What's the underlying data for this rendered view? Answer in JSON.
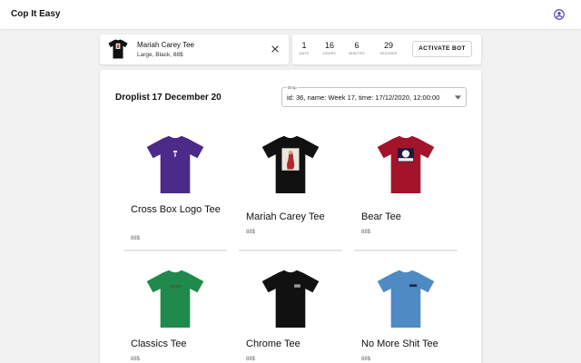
{
  "app": {
    "title": "Cop It Easy"
  },
  "header": {
    "account_icon": "account-circle-icon",
    "accent_color": "#5a3fbf"
  },
  "selected_item": {
    "name": "Mariah Carey Tee",
    "details": "Large, Black, 88$",
    "shirt_color": "#111111",
    "close_icon": "close-icon"
  },
  "countdown": {
    "units": [
      {
        "value": "1",
        "label": "Days"
      },
      {
        "value": "16",
        "label": "Hours"
      },
      {
        "value": "6",
        "label": "Minutes"
      },
      {
        "value": "29",
        "label": "Seconds"
      }
    ],
    "button_label": "ACTIVATE BOT"
  },
  "droplist": {
    "title": "Droplist 17 December 20",
    "select_label": "Drop",
    "select_value": "id: 36, name: Week 17, time: 17/12/2020, 12:00:00"
  },
  "products": [
    {
      "name": "Cross Box Logo Tee",
      "price": "88$",
      "shirt_color": "#4b2a8a",
      "graphic": "small-cross-logo"
    },
    {
      "name": "Mariah Carey Tee",
      "price": "88$",
      "shirt_color": "#111111",
      "graphic": "photo-print"
    },
    {
      "name": "Bear Tee",
      "price": "88$",
      "shirt_color": "#a3142a",
      "graphic": "bear-print"
    },
    {
      "name": "Classics Tee",
      "price": "88$",
      "shirt_color": "#1f8a4c",
      "graphic": "text-logo"
    },
    {
      "name": "Chrome Tee",
      "price": "88$",
      "shirt_color": "#111111",
      "graphic": "small-logo"
    },
    {
      "name": "No More Shit Tee",
      "price": "88$",
      "shirt_color": "#4e8ac4",
      "graphic": "small-logo"
    }
  ]
}
